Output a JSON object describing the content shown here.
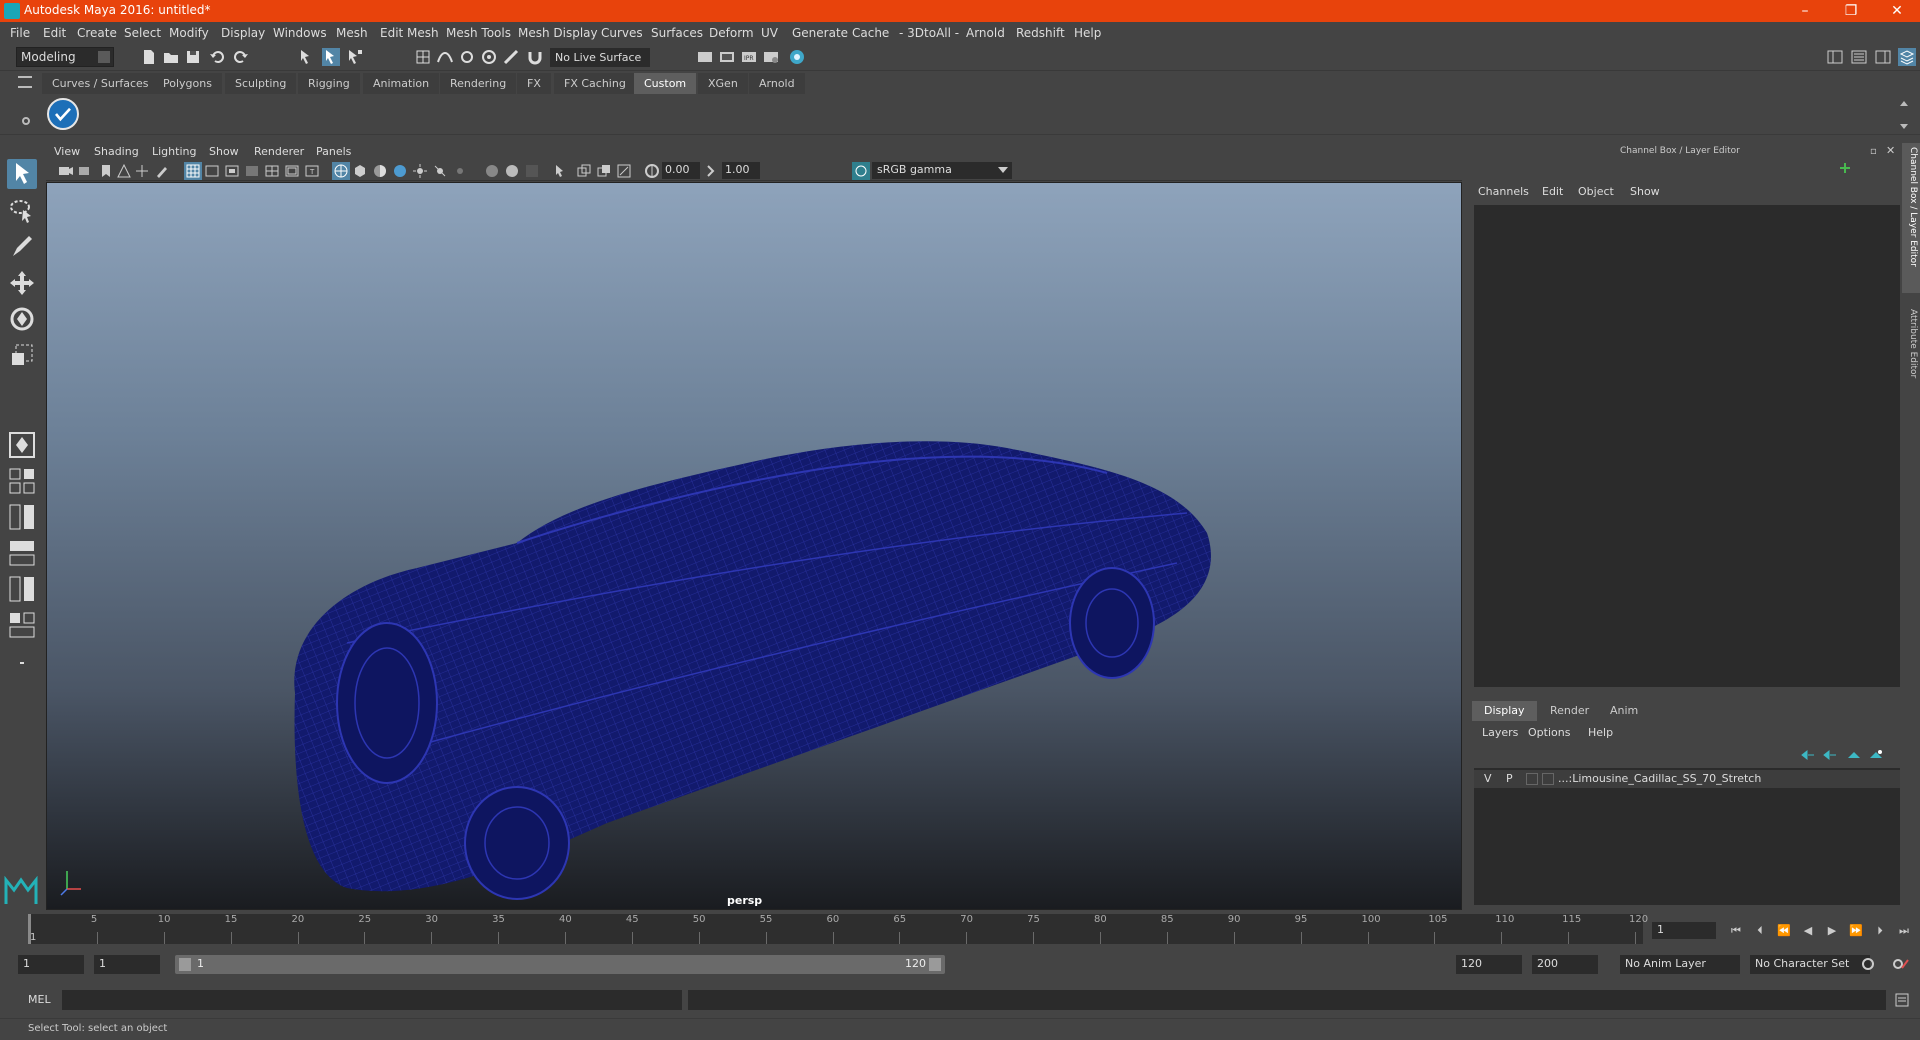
{
  "window": {
    "title": "Autodesk Maya 2016: untitled*",
    "min": "–",
    "max": "❐",
    "close": "✕"
  },
  "menus": [
    "File",
    "Edit",
    "Create",
    "Select",
    "Modify",
    "Display",
    "Windows",
    "Mesh",
    "Edit Mesh",
    "Mesh Tools",
    "Mesh Display",
    "Curves",
    "Surfaces",
    "Deform",
    "UV",
    "Generate",
    "Cache",
    "- 3DtoAll -",
    "Arnold",
    "Redshift",
    "Help"
  ],
  "statusline": {
    "mode": "Modeling",
    "live_surface": "No Live Surface"
  },
  "shelf_tabs": [
    "Curves / Surfaces",
    "Polygons",
    "Sculpting",
    "Rigging",
    "Animation",
    "Rendering",
    "FX",
    "FX Caching",
    "Custom",
    "XGen",
    "Arnold"
  ],
  "active_shelf": "Custom",
  "panel_menu": [
    "View",
    "Shading",
    "Lighting",
    "Show",
    "Renderer",
    "Panels"
  ],
  "panel_tools": {
    "exposure": "0.00",
    "gamma": "1.00",
    "color_space": "sRGB gamma"
  },
  "viewport": {
    "camera": "persp",
    "wire_color": "#1a1f7a"
  },
  "channel_box": {
    "title": "Channel Box / Layer Editor",
    "menus": [
      "Channels",
      "Edit",
      "Object",
      "Show"
    ],
    "tabs": [
      "Display",
      "Render",
      "Anim"
    ],
    "active_tab": "Display",
    "layer_menus": [
      "Layers",
      "Options",
      "Help"
    ],
    "layer": {
      "v": "V",
      "p": "P",
      "name": "...:Limousine_Cadillac_SS_70_Stretch"
    }
  },
  "side_tabs": [
    "Channel Box / Layer Editor",
    "Attribute Editor"
  ],
  "timeline": {
    "ticks": [
      "5",
      "10",
      "15",
      "20",
      "25",
      "30",
      "35",
      "40",
      "45",
      "50",
      "55",
      "60",
      "65",
      "70",
      "75",
      "80",
      "85",
      "90",
      "95",
      "100",
      "105",
      "110",
      "115",
      "120"
    ],
    "start_mark": "1",
    "current_frame": "1"
  },
  "range": {
    "start": "1",
    "playback_start": "1",
    "slider_start": "1",
    "slider_end": "120",
    "playback_end": "120",
    "end": "200",
    "anim_layer": "No Anim Layer",
    "character_set": "No Character Set"
  },
  "command": {
    "lang": "MEL"
  },
  "help_line": "Select Tool: select an object"
}
